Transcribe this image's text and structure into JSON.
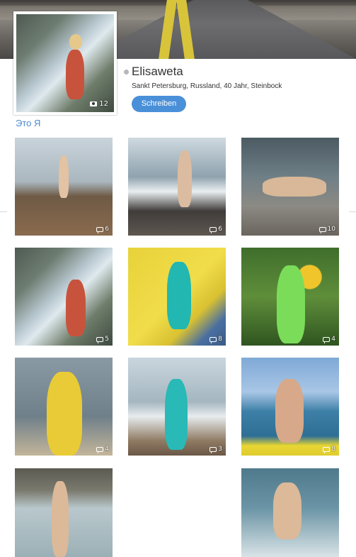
{
  "profile": {
    "name": "Elisaweta",
    "meta": "Sankt Petersburg, Russland, 40 Jahr, Steinbock",
    "write_button": "Schreiben",
    "avatar_photo_count": "12",
    "about_link": "Это Я"
  },
  "photos": [
    {
      "comments": "6",
      "scene": "sea-rocks"
    },
    {
      "comments": "6",
      "scene": "sea-waves"
    },
    {
      "comments": "10",
      "scene": "sea-lying"
    },
    {
      "comments": "5",
      "scene": "waterfall"
    },
    {
      "comments": "8",
      "scene": "yellow-stairs"
    },
    {
      "comments": "4",
      "scene": "sunflowers"
    },
    {
      "comments": "4",
      "scene": "yellow-dress"
    },
    {
      "comments": "3",
      "scene": "sailboat"
    },
    {
      "comments": "8",
      "scene": "beach-back"
    },
    {
      "comments": "",
      "scene": "sea-standing"
    },
    {
      "comments": "",
      "scene": "sea-water"
    }
  ]
}
